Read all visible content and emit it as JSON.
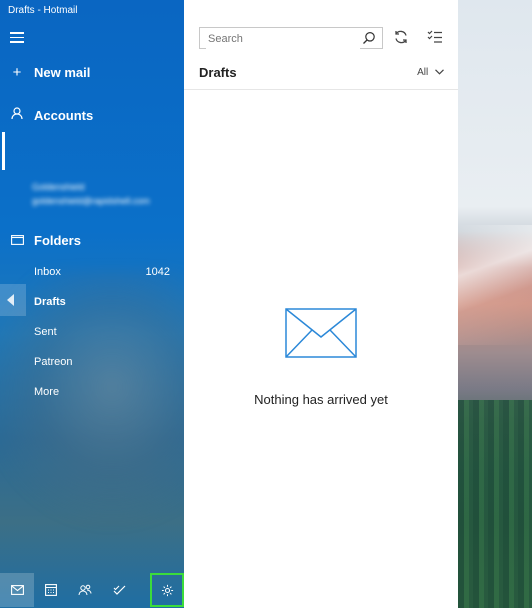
{
  "window": {
    "title": "Drafts - Hotmail"
  },
  "sidebar": {
    "new_mail": "New mail",
    "accounts": "Accounts",
    "account_name": "Goldenshield",
    "account_email": "goldenshield@rapidshell.com",
    "folders_label": "Folders",
    "folders": [
      {
        "label": "Inbox",
        "count": "1042"
      },
      {
        "label": "Drafts"
      },
      {
        "label": "Sent"
      },
      {
        "label": "Patreon"
      },
      {
        "label": "More"
      }
    ],
    "selected_folder": "Drafts",
    "bottom_icons": [
      "mail-icon",
      "calendar-icon",
      "people-icon",
      "todo-icon",
      "gear-icon"
    ]
  },
  "main": {
    "search_placeholder": "Search",
    "header": "Drafts",
    "filter": "All",
    "empty_message": "Nothing has arrived yet"
  },
  "colors": {
    "accent": "#0a66c2",
    "highlight": "#3bdc3b",
    "envelope": "#2b88d8"
  }
}
